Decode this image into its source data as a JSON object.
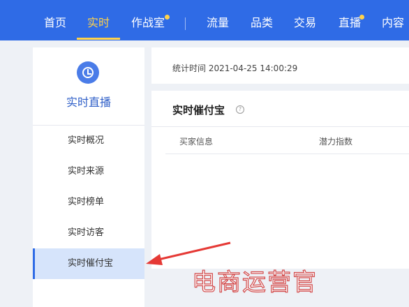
{
  "nav": {
    "items": [
      "首页",
      "实时",
      "作战室",
      "流量",
      "品类",
      "交易",
      "直播",
      "内容"
    ],
    "active": "实时"
  },
  "sidebar": {
    "title": "实时直播",
    "items": [
      "实时概况",
      "实时来源",
      "实时榜单",
      "实时访客",
      "实时催付宝"
    ],
    "active": "实时催付宝"
  },
  "stats": {
    "label": "统计时间 2021-04-25 14:00:29"
  },
  "panel": {
    "title": "实时催付宝",
    "columns": [
      "买家信息",
      "潜力指数"
    ]
  },
  "watermark": "电商运营官",
  "colors": {
    "brand": "#2f6be6",
    "highlight": "#ffd24a",
    "arrow": "#e53935"
  }
}
